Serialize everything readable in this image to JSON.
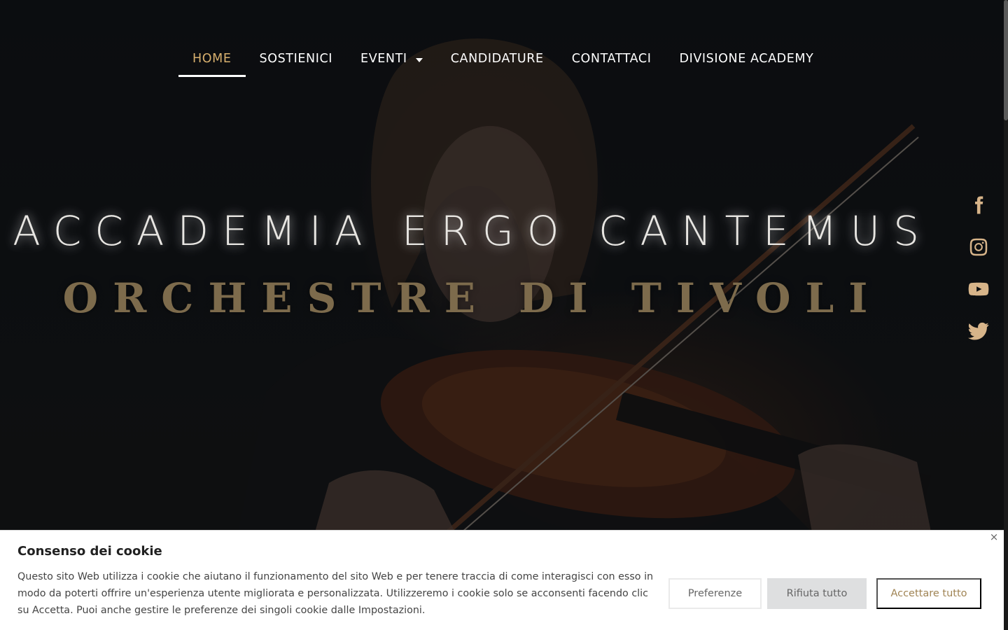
{
  "nav": {
    "items": [
      {
        "label": "HOME",
        "active": true
      },
      {
        "label": "SOSTIENICI"
      },
      {
        "label": "EVENTI",
        "has_dropdown": true
      },
      {
        "label": "CANDIDATURE"
      },
      {
        "label": "CONTATTACI"
      },
      {
        "label": "DIVISIONE ACADEMY"
      }
    ]
  },
  "hero": {
    "title": "ACCADEMIA ERGO CANTEMUS",
    "subtitle": "ORCHESTRE DI TIVOLI"
  },
  "social": [
    "facebook-icon",
    "instagram-icon",
    "youtube-icon",
    "twitter-icon"
  ],
  "cookie": {
    "title": "Consenso dei cookie",
    "text": "Questo sito Web utilizza i cookie che aiutano il funzionamento del sito Web e per tenere traccia di come interagisci con esso in modo da poterti offrire un'esperienza utente migliorata e personalizzata. Utilizzeremo i cookie solo se acconsenti facendo clic su Accetta. Puoi anche gestire le preferenze dei singoli cookie dalle Impostazioni.",
    "close": "×",
    "preferences_label": "Preferenze",
    "reject_label": "Rifiuta tutto",
    "accept_label": "Accettare tutto"
  },
  "colors": {
    "accent_gold": "#d8b06e",
    "subtitle_gold": "#7d6b4c",
    "icon_gold": "#d7b489",
    "accept_text": "#a08454"
  }
}
